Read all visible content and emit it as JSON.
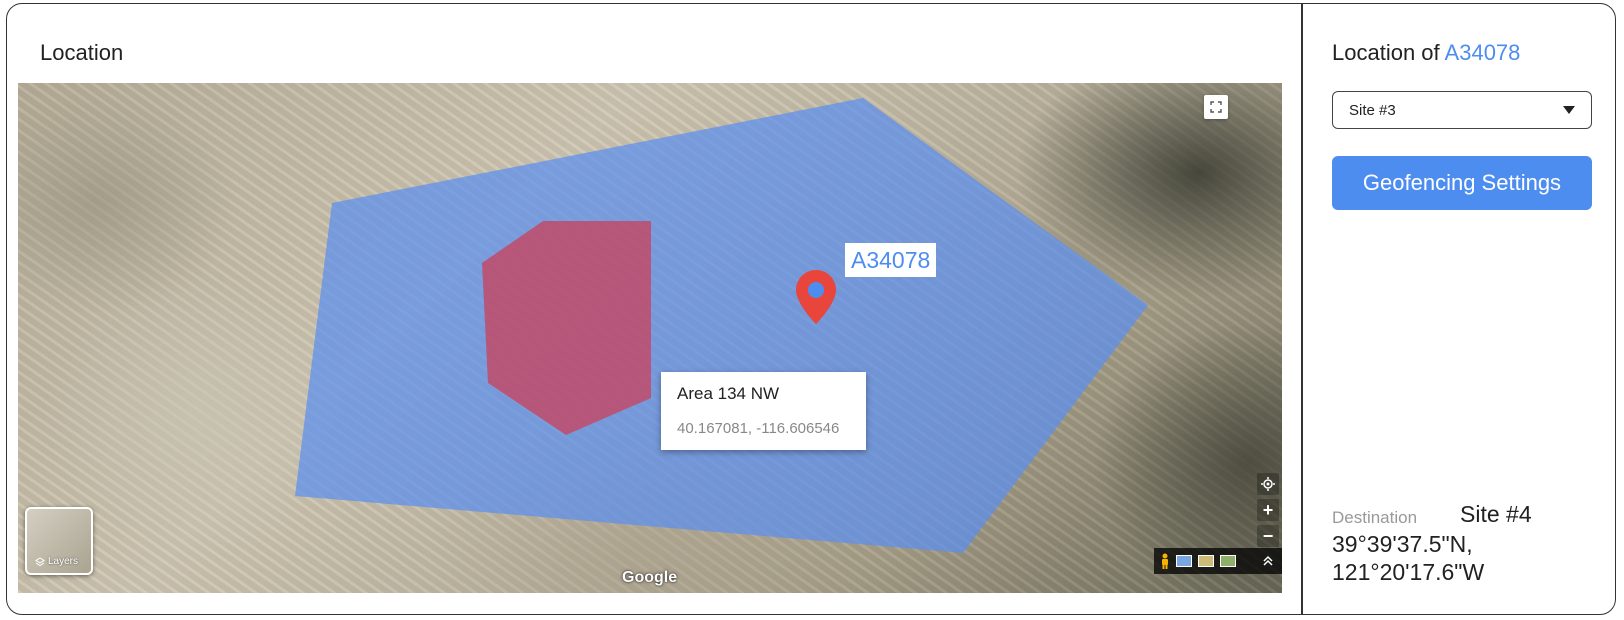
{
  "left_panel": {
    "title": "Location"
  },
  "map": {
    "asset_tag": "A34078",
    "info_box": {
      "title": "Area 134 NW",
      "coords": "40.167081, -116.606546"
    },
    "layers_label": "Layers",
    "attribution": "Google",
    "colors": {
      "geofence_blue": "#5b8ff0",
      "geofence_red": "#c8445f",
      "pin": "#e8453c"
    }
  },
  "right_panel": {
    "title_prefix": "Location of ",
    "asset_id": "A34078",
    "site_select": {
      "value": "Site #3"
    },
    "geofencing_button": "Geofencing Settings",
    "destination": {
      "label": "Destination",
      "site": "Site #4",
      "coords": "39°39'37.5\"N, 121°20'17.6\"W"
    }
  },
  "colors": {
    "accent": "#4e8df0"
  }
}
